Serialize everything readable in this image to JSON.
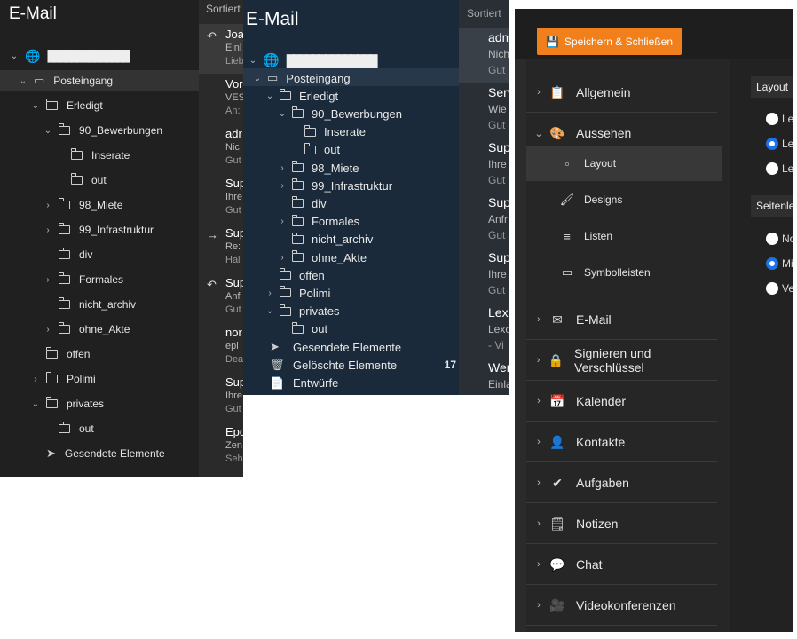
{
  "panel1": {
    "title": "E-Mail",
    "account": "██████████████",
    "folders": [
      {
        "label": "Posteingang",
        "chev": "⌄",
        "indent": 0,
        "icon": "inbox-icon"
      },
      {
        "label": "Erledigt",
        "chev": "⌄",
        "indent": 1,
        "icon": "folder-icon"
      },
      {
        "label": "90_Bewerbungen",
        "chev": "⌄",
        "indent": 2,
        "icon": "folder-icon"
      },
      {
        "label": "Inserate",
        "chev": "",
        "indent": 3,
        "icon": "folder-icon"
      },
      {
        "label": "out",
        "chev": "",
        "indent": 3,
        "icon": "folder-icon"
      },
      {
        "label": "98_Miete",
        "chev": "›",
        "indent": 2,
        "icon": "folder-icon"
      },
      {
        "label": "99_Infrastruktur",
        "chev": "›",
        "indent": 2,
        "icon": "folder-icon"
      },
      {
        "label": "div",
        "chev": "",
        "indent": 2,
        "icon": "folder-icon"
      },
      {
        "label": "Formales",
        "chev": "›",
        "indent": 2,
        "icon": "folder-icon"
      },
      {
        "label": "nicht_archiv",
        "chev": "",
        "indent": 2,
        "icon": "folder-icon"
      },
      {
        "label": "ohne_Akte",
        "chev": "›",
        "indent": 2,
        "icon": "folder-icon"
      },
      {
        "label": "offen",
        "chev": "",
        "indent": 1,
        "icon": "folder-icon"
      },
      {
        "label": "Polimi",
        "chev": "›",
        "indent": 1,
        "icon": "folder-icon"
      },
      {
        "label": "privates",
        "chev": "⌄",
        "indent": 1,
        "icon": "folder-icon"
      },
      {
        "label": "out",
        "chev": "",
        "indent": 2,
        "icon": "folder-icon"
      },
      {
        "label": "Gesendete Elemente",
        "chev": "",
        "indent": 1,
        "icon": "send-icon"
      }
    ],
    "sort_label": "Sortiert",
    "messages": [
      {
        "l1": "Joa",
        "l2": "Einl",
        "l3": "Lieb",
        "icon": "↶"
      },
      {
        "l1": "Vor",
        "l2": "VES",
        "l3": "An:",
        "icon": ""
      },
      {
        "l1": "adr",
        "l2": "Nic",
        "l3": "Gut",
        "icon": ""
      },
      {
        "l1": "Sup",
        "l2": "Ihre",
        "l3": "Gut",
        "icon": ""
      },
      {
        "l1": "Sup",
        "l2": "Re:",
        "l3": "Hal",
        "icon": "→"
      },
      {
        "l1": "Sup",
        "l2": "Anf",
        "l3": "Gut",
        "icon": "↶"
      },
      {
        "l1": "nor",
        "l2": "epi",
        "l3": "Dea",
        "icon": ""
      },
      {
        "l1": "Sup",
        "l2": "Ihre",
        "l3": "Gut",
        "icon": ""
      },
      {
        "l1": "Epo",
        "l2": "Zen",
        "l3": "Seh",
        "icon": ""
      }
    ]
  },
  "panel2": {
    "title": "E-Mail",
    "account": "██████████████",
    "folders": [
      {
        "label": "Posteingang",
        "chev": "⌄",
        "indent": 0
      },
      {
        "label": "Erledigt",
        "chev": "⌄",
        "indent": 1
      },
      {
        "label": "90_Bewerbungen",
        "chev": "⌄",
        "indent": 2
      },
      {
        "label": "Inserate",
        "chev": "",
        "indent": 3
      },
      {
        "label": "out",
        "chev": "",
        "indent": 3
      },
      {
        "label": "98_Miete",
        "chev": "›",
        "indent": 2
      },
      {
        "label": "99_Infrastruktur",
        "chev": "›",
        "indent": 2
      },
      {
        "label": "div",
        "chev": "",
        "indent": 2
      },
      {
        "label": "Formales",
        "chev": "›",
        "indent": 2
      },
      {
        "label": "nicht_archiv",
        "chev": "",
        "indent": 2
      },
      {
        "label": "ohne_Akte",
        "chev": "›",
        "indent": 2
      },
      {
        "label": "offen",
        "chev": "",
        "indent": 1
      },
      {
        "label": "Polimi",
        "chev": "›",
        "indent": 1
      },
      {
        "label": "privates",
        "chev": "⌄",
        "indent": 1
      },
      {
        "label": "out",
        "chev": "",
        "indent": 2
      }
    ],
    "special": [
      {
        "label": "Gesendete Elemente",
        "icon": "➤",
        "name": "send-icon",
        "count": ""
      },
      {
        "label": "Gelöschte Elemente",
        "icon": "🗑",
        "name": "trash-icon",
        "count": "17"
      },
      {
        "label": "Entwürfe",
        "icon": "📄",
        "name": "draft-icon",
        "count": ""
      }
    ],
    "sort_label": "Sortiert",
    "messages": [
      {
        "l1": "adm",
        "l2": "Nich",
        "l3": "Gut"
      },
      {
        "l1": "Serv",
        "l2": "Wie",
        "l3": "Gut"
      },
      {
        "l1": "Sup",
        "l2": "Ihre",
        "l3": "Gut"
      },
      {
        "l1": "Sup",
        "l2": "Anfr",
        "l3": "Gut"
      },
      {
        "l1": "Sup",
        "l2": "Ihre",
        "l3": "Gut"
      },
      {
        "l1": "Lex",
        "l2": "Lexo",
        "l3": "- Vi"
      },
      {
        "l1": "Wer",
        "l2": "Einla",
        "l3": ""
      }
    ]
  },
  "panel3": {
    "save_button": "Speichern & Schließen",
    "nav": [
      {
        "label": "Allgemein",
        "chev": "›",
        "icon": "📋",
        "name": "general-icon"
      },
      {
        "label": "Aussehen",
        "chev": "⌄",
        "icon": "🎨",
        "name": "palette-icon"
      },
      {
        "label": "E-Mail",
        "chev": "›",
        "icon": "✉",
        "name": "mail-icon"
      },
      {
        "label": "Signieren und Verschlüssel",
        "chev": "›",
        "icon": "🔒",
        "name": "lock-icon"
      },
      {
        "label": "Kalender",
        "chev": "›",
        "icon": "📅",
        "name": "calendar-icon"
      },
      {
        "label": "Kontakte",
        "chev": "›",
        "icon": "👤",
        "name": "contact-icon"
      },
      {
        "label": "Aufgaben",
        "chev": "›",
        "icon": "✔",
        "name": "check-icon"
      },
      {
        "label": "Notizen",
        "chev": "›",
        "icon": "🗒",
        "name": "notes-icon"
      },
      {
        "label": "Chat",
        "chev": "›",
        "icon": "💬",
        "name": "chat-icon"
      },
      {
        "label": "Videokonferenzen",
        "chev": "›",
        "icon": "🎥",
        "name": "video-icon"
      }
    ],
    "subnav": [
      {
        "label": "Layout",
        "icon": "▫",
        "name": "layout-icon"
      },
      {
        "label": "Designs",
        "icon": "🖌",
        "name": "brush-icon"
      },
      {
        "label": "Listen",
        "icon": "≡",
        "name": "list-icon"
      },
      {
        "label": "Symbolleisten",
        "icon": "▭",
        "name": "toolbar-icon"
      }
    ],
    "layout_section": "Layout",
    "layout_options": [
      {
        "label": "Le",
        "checked": false
      },
      {
        "label": "Le",
        "checked": true
      },
      {
        "label": "Le",
        "checked": false
      }
    ],
    "side_section": "Seitenle",
    "side_options": [
      {
        "label": "No",
        "checked": false
      },
      {
        "label": "Mi",
        "checked": true
      },
      {
        "label": "Ve",
        "checked": false
      }
    ]
  },
  "colors": {
    "accent": "#f07f1c",
    "radio": "#1a73e8"
  }
}
